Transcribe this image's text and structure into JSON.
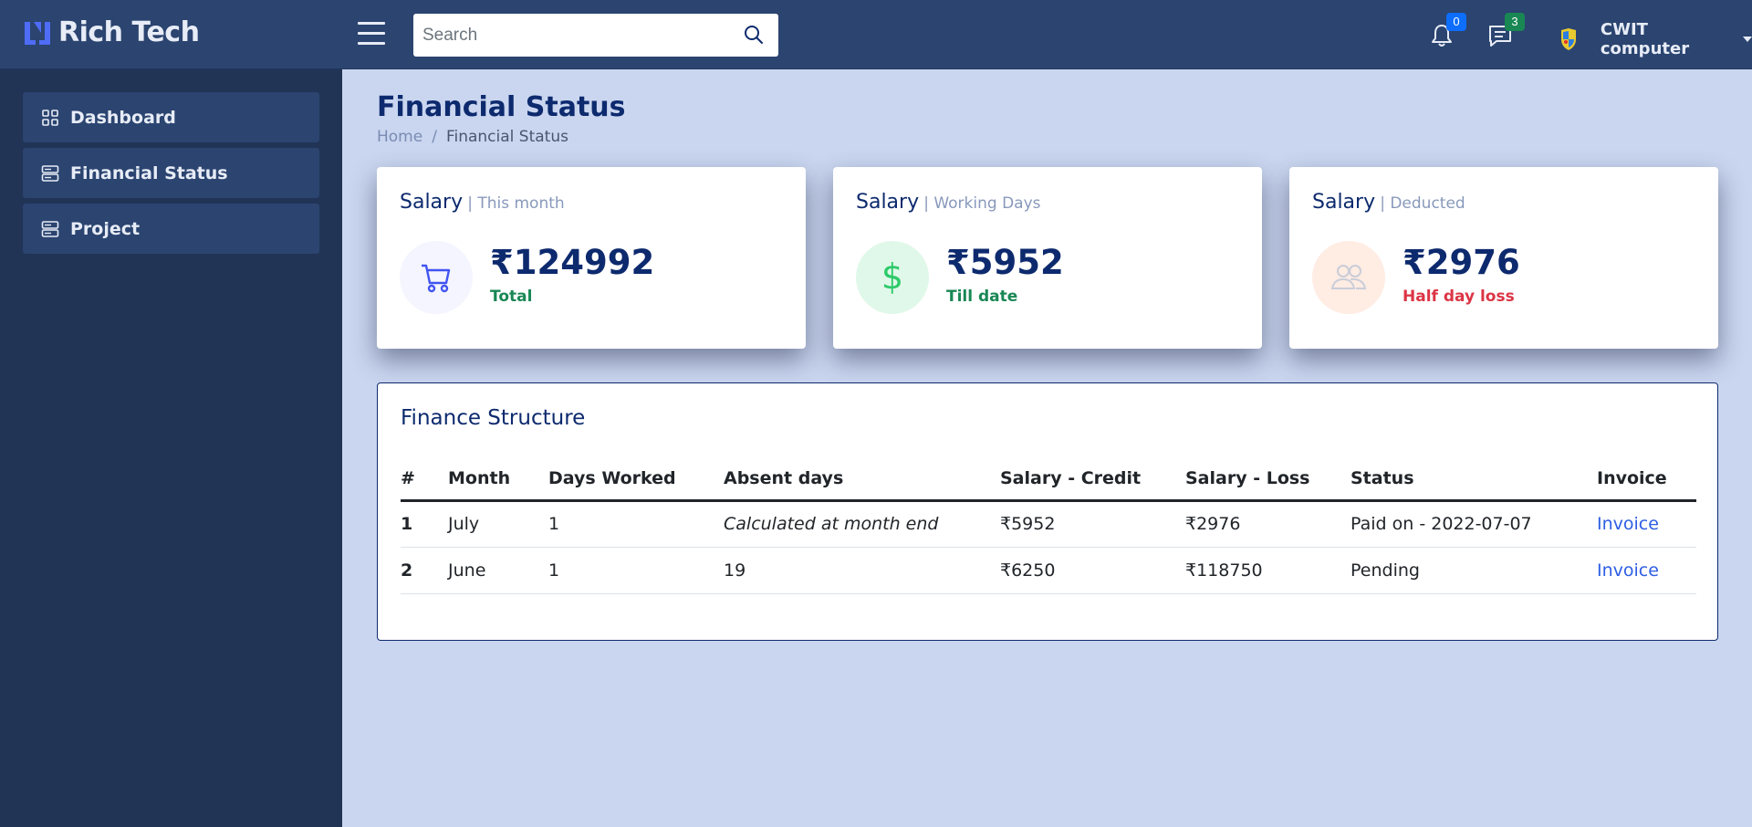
{
  "header": {
    "brand": "Rich Tech",
    "search_placeholder": "Search",
    "notifications_count": "0",
    "messages_count": "3",
    "user_name": "CWIT computer"
  },
  "sidebar": {
    "items": [
      {
        "label": "Dashboard",
        "icon": "grid-icon"
      },
      {
        "label": "Financial Status",
        "icon": "server-icon"
      },
      {
        "label": "Project",
        "icon": "server-icon"
      }
    ]
  },
  "page": {
    "title": "Financial Status",
    "breadcrumb": {
      "home": "Home",
      "separator": "/",
      "current": "Financial Status"
    }
  },
  "cards": [
    {
      "title": "Salary",
      "subtitle": "| This month",
      "value": "₹124992",
      "label": "Total",
      "label_color": "#198754",
      "icon": "cart-icon",
      "icon_bg": "#f4f5fe",
      "icon_color": "#4154f1"
    },
    {
      "title": "Salary",
      "subtitle": "| Working Days",
      "value": "₹5952",
      "label": "Till date",
      "label_color": "#198754",
      "icon": "dollar-icon",
      "icon_bg": "#e0f8e9",
      "icon_color": "#2eca6a"
    },
    {
      "title": "Salary",
      "subtitle": "| Deducted",
      "value": "₹2976",
      "label": "Half day loss",
      "label_color": "#dc3545",
      "icon": "people-icon",
      "icon_bg": "#ffece3",
      "icon_color": "#c9cdd8"
    }
  ],
  "finance": {
    "title": "Finance Structure",
    "columns": [
      "#",
      "Month",
      "Days Worked",
      "Absent days",
      "Salary - Credit",
      "Salary - Loss",
      "Status",
      "Invoice"
    ],
    "rows": [
      [
        "1",
        "July",
        "1",
        "Calculated at month end",
        "₹5952",
        "₹2976",
        "Paid on - 2022-07-07",
        "Invoice"
      ],
      [
        "2",
        "June",
        "1",
        "19",
        "₹6250",
        "₹118750",
        "Pending",
        "Invoice"
      ]
    ]
  },
  "colors": {
    "header_bg": "#2b4470",
    "sidebar_bg": "#213456",
    "content_bg": "#cad6f0",
    "accent": "#0d2a6e",
    "link": "#2d5ee3"
  }
}
